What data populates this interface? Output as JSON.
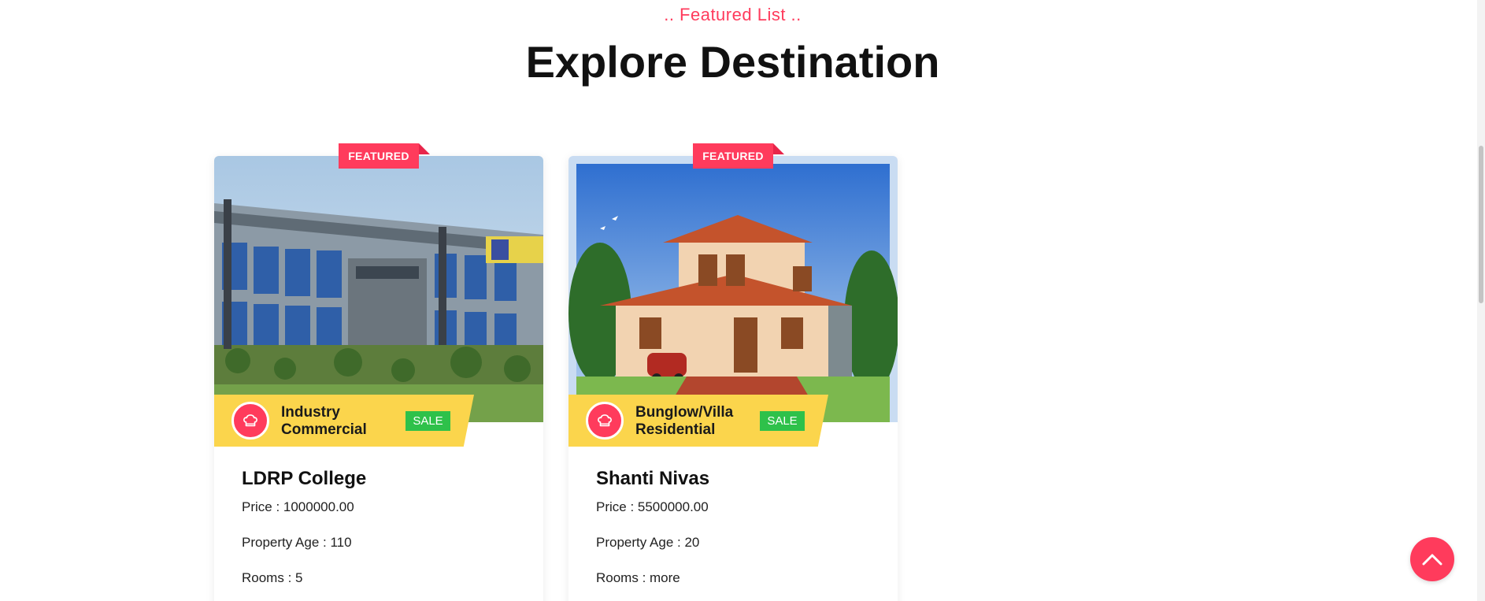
{
  "section": {
    "subtitle": ".. Featured List ..",
    "title": "Explore Destination"
  },
  "cards": [
    {
      "ribbon": "FEATURED",
      "category_line1": "Industry",
      "category_line2": "Commercial",
      "badge": "SALE",
      "name": "LDRP College",
      "price": "Price : 1000000.00",
      "age": "Property Age : 110",
      "rooms": "Rooms : 5",
      "icon": "chef-hat-icon"
    },
    {
      "ribbon": "FEATURED",
      "category_line1": "Bunglow/Villa",
      "category_line2": "Residential",
      "badge": "SALE",
      "name": "Shanti Nivas",
      "price": "Price : 5500000.00",
      "age": "Property Age : 20",
      "rooms": "Rooms : more",
      "icon": "chef-hat-icon"
    }
  ],
  "colors": {
    "accent": "#ff3b5c",
    "band": "#fbd54c",
    "badge": "#2ec14a"
  }
}
